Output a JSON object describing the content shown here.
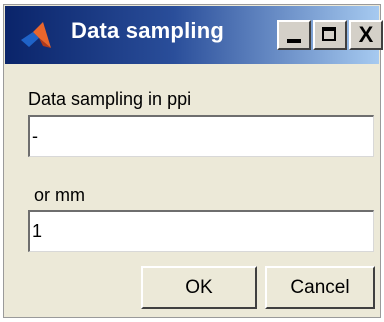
{
  "window": {
    "title": "Data sampling",
    "icon": "matlab-logo-icon",
    "controls": {
      "minimize_icon": "minimize-icon",
      "maximize_icon": "maximize-icon",
      "close_glyph": "X"
    }
  },
  "form": {
    "ppi_label": "Data sampling in ppi",
    "ppi_value": "-",
    "mm_label": "or mm",
    "mm_value": "1"
  },
  "buttons": {
    "ok": "OK",
    "cancel": "Cancel"
  },
  "colors": {
    "titlebar_start": "#0a246a",
    "titlebar_end": "#a6caf0",
    "dialog_bg": "#ece9d8"
  }
}
